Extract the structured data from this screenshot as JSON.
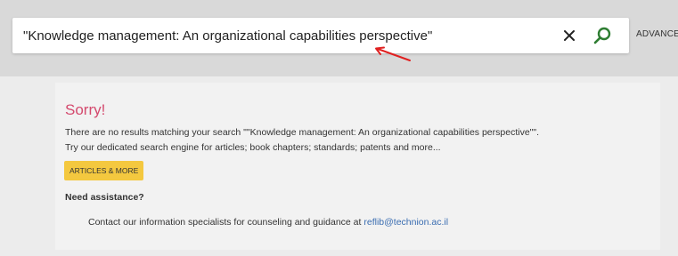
{
  "search": {
    "query": "\"Knowledge management: An organizational capabilities perspective\"",
    "advanced_label": "ADVANCED"
  },
  "icons": {
    "clear": "close-icon",
    "search": "search-icon",
    "search_color": "#2e7d32"
  },
  "result": {
    "title": "Sorry!",
    "no_results_text": "There are no results matching your search \"\"Knowledge management: An organizational capabilities perspective\"\".",
    "try_text": "Try our dedicated search engine for articles; book chapters; standards; patents and more...",
    "articles_button_label": "ARTICLES & MORE",
    "assist_heading": "Need assistance?",
    "contact_text": "Contact our information specialists for counseling and guidance at ",
    "contact_email": "reflib@technion.ac.il"
  },
  "colors": {
    "sorry_title": "#d44a6e",
    "button_bg": "#f4c83f",
    "link": "#3a6db1",
    "annotation_arrow": "#e02020"
  }
}
